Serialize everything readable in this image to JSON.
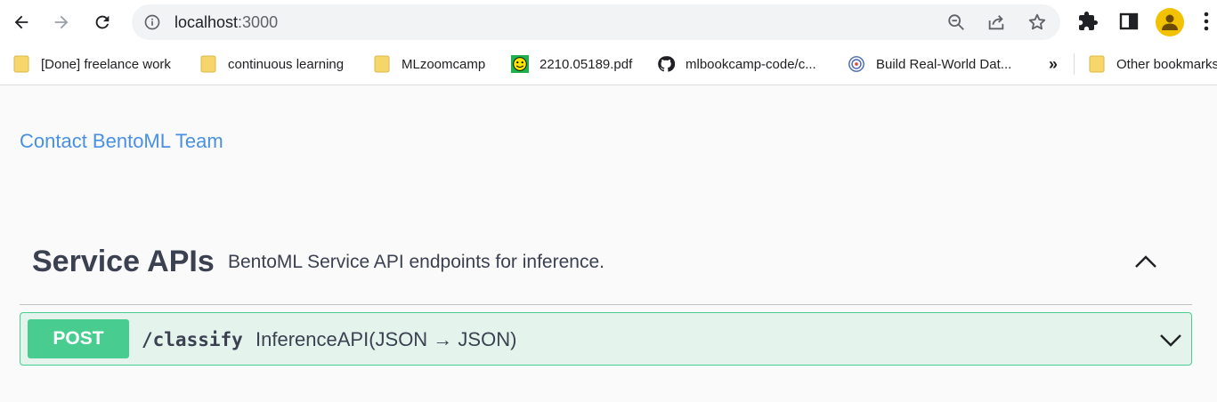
{
  "browser": {
    "url_host": "localhost",
    "url_port": ":3000",
    "overflow_label": "»",
    "bookmarks": [
      {
        "label": "[Done] freelance work",
        "icon": "folder-icon"
      },
      {
        "label": "continuous learning",
        "icon": "folder-icon"
      },
      {
        "label": "MLzoomcamp",
        "icon": "folder-icon"
      },
      {
        "label": "2210.05189.pdf",
        "icon": "smiley-favicon-icon"
      },
      {
        "label": "mlbookcamp-code/c...",
        "icon": "github-icon"
      },
      {
        "label": "Build Real-World Dat...",
        "icon": "target-favicon-icon"
      },
      {
        "label": "Other bookmarks",
        "icon": "folder-icon"
      }
    ]
  },
  "page": {
    "contact_link": "Contact BentoML Team",
    "section": {
      "title": "Service APIs",
      "description": "BentoML Service API endpoints for inference."
    },
    "operation": {
      "method": "POST",
      "path": "/classify",
      "summary": "InferenceAPI(JSON → JSON)"
    }
  },
  "colors": {
    "post_green": "#49cc90",
    "link_blue": "#4990e2",
    "text_dark": "#3b4151",
    "folder_yellow": "#f6d66b"
  }
}
